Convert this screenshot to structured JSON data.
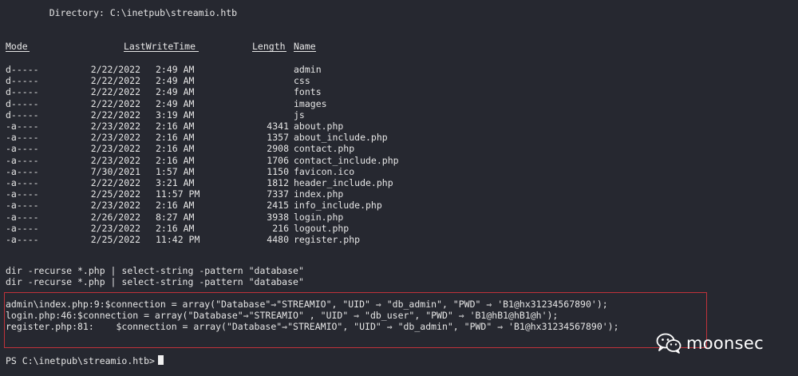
{
  "directory_header": "    Directory: C:\\inetpub\\streamio.htb",
  "columns": {
    "mode": "Mode",
    "last_write_time": "LastWriteTime",
    "length": "Length",
    "name": "Name"
  },
  "entries": [
    {
      "mode": "d-----",
      "date": "2/22/2022",
      "time": "2:49 AM",
      "length": "",
      "name": "admin"
    },
    {
      "mode": "d-----",
      "date": "2/22/2022",
      "time": "2:49 AM",
      "length": "",
      "name": "css"
    },
    {
      "mode": "d-----",
      "date": "2/22/2022",
      "time": "2:49 AM",
      "length": "",
      "name": "fonts"
    },
    {
      "mode": "d-----",
      "date": "2/22/2022",
      "time": "2:49 AM",
      "length": "",
      "name": "images"
    },
    {
      "mode": "d-----",
      "date": "2/22/2022",
      "time": "3:19 AM",
      "length": "",
      "name": "js"
    },
    {
      "mode": "-a----",
      "date": "2/23/2022",
      "time": "2:16 AM",
      "length": "4341",
      "name": "about.php"
    },
    {
      "mode": "-a----",
      "date": "2/23/2022",
      "time": "2:16 AM",
      "length": "1357",
      "name": "about_include.php"
    },
    {
      "mode": "-a----",
      "date": "2/23/2022",
      "time": "2:16 AM",
      "length": "2908",
      "name": "contact.php"
    },
    {
      "mode": "-a----",
      "date": "2/23/2022",
      "time": "2:16 AM",
      "length": "1706",
      "name": "contact_include.php"
    },
    {
      "mode": "-a----",
      "date": "7/30/2021",
      "time": "1:57 AM",
      "length": "1150",
      "name": "favicon.ico"
    },
    {
      "mode": "-a----",
      "date": "2/22/2022",
      "time": "3:21 AM",
      "length": "1812",
      "name": "header_include.php"
    },
    {
      "mode": "-a----",
      "date": "2/25/2022",
      "time": "11:57 PM",
      "length": "7337",
      "name": "index.php"
    },
    {
      "mode": "-a----",
      "date": "2/23/2022",
      "time": "2:16 AM",
      "length": "2415",
      "name": "info_include.php"
    },
    {
      "mode": "-a----",
      "date": "2/26/2022",
      "time": "8:27 AM",
      "length": "3938",
      "name": "login.php"
    },
    {
      "mode": "-a----",
      "date": "2/23/2022",
      "time": "2:16 AM",
      "length": "216",
      "name": "logout.php"
    },
    {
      "mode": "-a----",
      "date": "2/25/2022",
      "time": "11:42 PM",
      "length": "4480",
      "name": "register.php"
    }
  ],
  "commands": [
    "dir -recurse *.php | select-string -pattern \"database\"",
    "dir -recurse *.php | select-string -pattern \"database\""
  ],
  "results": [
    "admin\\index.php:9:$connection = array(\"Database\"⇒\"STREAMIO\", \"UID\" ⇒ \"db_admin\", \"PWD\" ⇒ 'B1@hx31234567890');",
    "login.php:46:$connection = array(\"Database\"⇒\"STREAMIO\" , \"UID\" ⇒ \"db_user\", \"PWD\" ⇒ 'B1@hB1@hB1@h');",
    "register.php:81:    $connection = array(\"Database\"⇒\"STREAMIO\", \"UID\" ⇒ \"db_admin\", \"PWD\" ⇒ 'B1@hx31234567890');"
  ],
  "prompt": "PS C:\\inetpub\\streamio.htb>",
  "watermark": "moonsec",
  "colors": {
    "background": "#262830",
    "text": "#e6e6e6",
    "highlight_border": "#c0323a"
  }
}
